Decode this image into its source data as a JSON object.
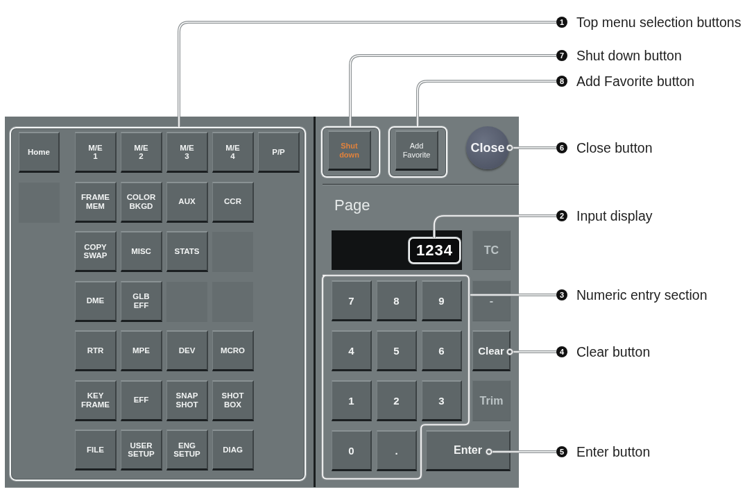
{
  "menu_panel": {
    "rows": [
      [
        {
          "kind": "key",
          "label": "Home"
        },
        {
          "kind": "key",
          "label": "M/E\n1"
        },
        {
          "kind": "key",
          "label": "M/E\n2"
        },
        {
          "kind": "key",
          "label": "M/E\n3"
        },
        {
          "kind": "key",
          "label": "M/E\n4"
        },
        {
          "kind": "key",
          "label": "P/P"
        }
      ],
      [
        {
          "kind": "blank"
        },
        {
          "kind": "key",
          "label": "FRAME\nMEM"
        },
        {
          "kind": "key",
          "label": "COLOR\nBKGD"
        },
        {
          "kind": "key",
          "label": "AUX"
        },
        {
          "kind": "key",
          "label": "CCR"
        }
      ],
      [
        {
          "kind": "gap"
        },
        {
          "kind": "key",
          "label": "COPY\nSWAP"
        },
        {
          "kind": "key",
          "label": "MISC"
        },
        {
          "kind": "key",
          "label": "STATS"
        },
        {
          "kind": "blank"
        }
      ],
      [
        {
          "kind": "gap"
        },
        {
          "kind": "key",
          "label": "DME"
        },
        {
          "kind": "key",
          "label": "GLB\nEFF"
        },
        {
          "kind": "blank"
        },
        {
          "kind": "blank"
        }
      ],
      [
        {
          "kind": "gap"
        },
        {
          "kind": "key",
          "label": "RTR"
        },
        {
          "kind": "key",
          "label": "MPE"
        },
        {
          "kind": "key",
          "label": "DEV"
        },
        {
          "kind": "key",
          "label": "MCRO"
        }
      ],
      [
        {
          "kind": "gap"
        },
        {
          "kind": "key",
          "label": "KEY\nFRAME"
        },
        {
          "kind": "key",
          "label": "EFF"
        },
        {
          "kind": "key",
          "label": "SNAP\nSHOT"
        },
        {
          "kind": "key",
          "label": "SHOT\nBOX"
        }
      ],
      [
        {
          "kind": "gap"
        },
        {
          "kind": "key",
          "label": "FILE"
        },
        {
          "kind": "key",
          "label": "USER\nSETUP"
        },
        {
          "kind": "key",
          "label": "ENG\nSETUP"
        },
        {
          "kind": "key",
          "label": "DIAG"
        }
      ]
    ]
  },
  "control_panel": {
    "top_buttons": [
      {
        "kind": "shutdown",
        "label": "Shut\ndown"
      },
      {
        "kind": "favorite",
        "label": "Add\nFavorite"
      },
      {
        "kind": "close",
        "label": "Close"
      }
    ],
    "page_label": "Page",
    "input_display": {
      "value": "1234"
    },
    "tc_key": {
      "label": "TC",
      "disabled": true
    },
    "keypad": [
      [
        {
          "kind": "digit",
          "label": "7",
          "disabled": false
        },
        {
          "kind": "digit",
          "label": "8",
          "disabled": false
        },
        {
          "kind": "digit",
          "label": "9",
          "disabled": false
        },
        {
          "kind": "side",
          "label": "-",
          "disabled": true
        }
      ],
      [
        {
          "kind": "digit",
          "label": "4",
          "disabled": false
        },
        {
          "kind": "digit",
          "label": "5",
          "disabled": false
        },
        {
          "kind": "digit",
          "label": "6",
          "disabled": false
        },
        {
          "kind": "side",
          "label": "Clear",
          "disabled": false
        }
      ],
      [
        {
          "kind": "digit",
          "label": "1",
          "disabled": false
        },
        {
          "kind": "digit",
          "label": "2",
          "disabled": false
        },
        {
          "kind": "digit",
          "label": "3",
          "disabled": false
        },
        {
          "kind": "side",
          "label": "Trim",
          "disabled": true
        }
      ],
      [
        {
          "kind": "digit",
          "label": "0",
          "disabled": false
        },
        {
          "kind": "digit",
          "label": ".",
          "disabled": false
        },
        {
          "kind": "enter",
          "label": "Enter",
          "disabled": false
        }
      ]
    ]
  },
  "callouts": [
    {
      "number": "1",
      "text": "Top menu selection buttons"
    },
    {
      "number": "7",
      "text": "Shut down button"
    },
    {
      "number": "8",
      "text": "Add Favorite button"
    },
    {
      "number": "6",
      "text": "Close button"
    },
    {
      "number": "2",
      "text": "Input display"
    },
    {
      "number": "3",
      "text": "Numeric entry section"
    },
    {
      "number": "4",
      "text": "Clear button"
    },
    {
      "number": "5",
      "text": "Enter button"
    }
  ]
}
